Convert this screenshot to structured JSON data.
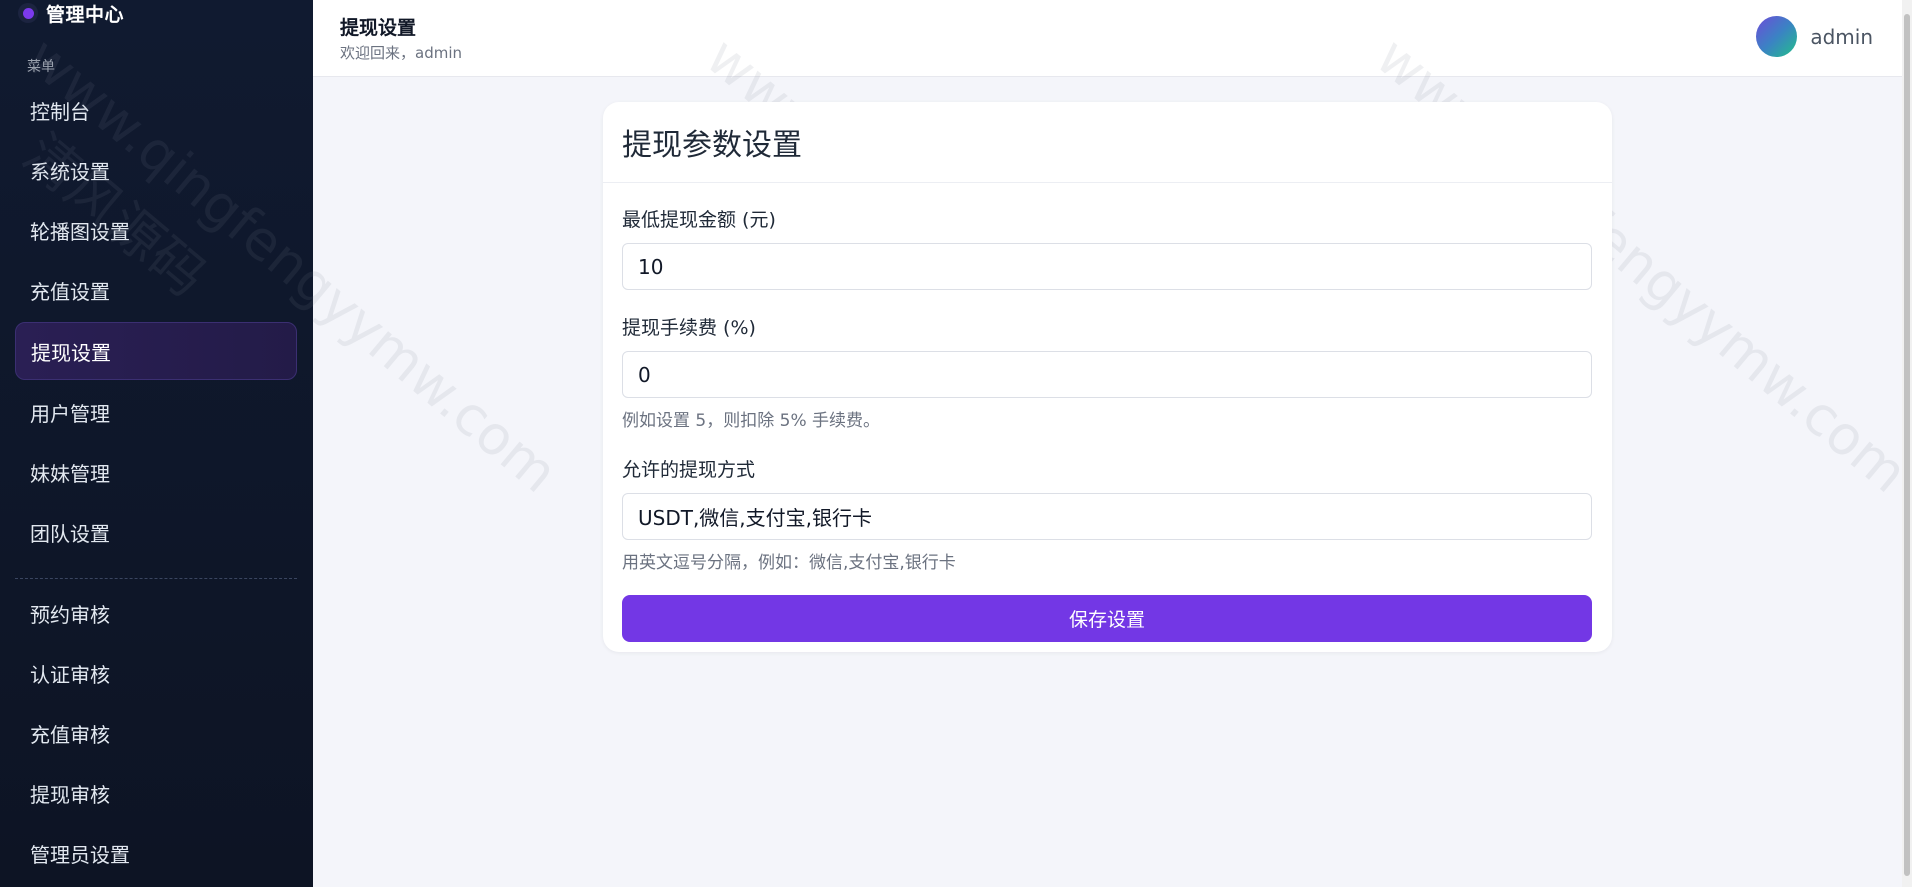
{
  "sidebar": {
    "brand_title": "管理中心",
    "menu_caption": "菜单",
    "items_top": [
      {
        "label": "控制台"
      },
      {
        "label": "系统设置"
      },
      {
        "label": "轮播图设置"
      },
      {
        "label": "充值设置"
      },
      {
        "label": "提现设置",
        "active": true
      },
      {
        "label": "用户管理"
      },
      {
        "label": "妹妹管理"
      },
      {
        "label": "团队设置"
      }
    ],
    "items_bottom": [
      {
        "label": "预约审核"
      },
      {
        "label": "认证审核"
      },
      {
        "label": "充值审核"
      },
      {
        "label": "提现审核"
      },
      {
        "label": "管理员设置"
      }
    ]
  },
  "header": {
    "title": "提现设置",
    "subtitle": "欢迎回来，admin",
    "user_name": "admin"
  },
  "card": {
    "title": "提现参数设置",
    "min_amount": {
      "label": "最低提现金额 (元)",
      "value": "10"
    },
    "fee": {
      "label": "提现手续费 (%)",
      "value": "0",
      "help": "例如设置 5，则扣除 5% 手续费。"
    },
    "methods": {
      "label": "允许的提现方式",
      "value": "USDT,微信,支付宝,银行卡",
      "help": "用英文逗号分隔，例如：微信,支付宝,银行卡"
    },
    "save_label": "保存设置"
  },
  "watermark": {
    "line1": "www.qingfengyymw.com",
    "line2": "清风源码"
  },
  "colors": {
    "accent": "#7337e5",
    "sidebar_bg": "#101a30",
    "page_bg": "#f4f5fa"
  }
}
